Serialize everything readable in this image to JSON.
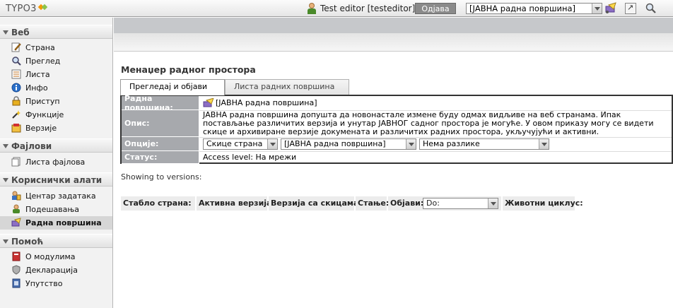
{
  "topbar": {
    "logo_text": "TYPO3",
    "user_label": "Test editor [testeditor]",
    "logout_label": "Одјава",
    "workspace_select": "[ЈАВНА радна површина]"
  },
  "sidebar": {
    "groups": [
      {
        "label": "Веб",
        "items": [
          {
            "label": "Страна"
          },
          {
            "label": "Преглед"
          },
          {
            "label": "Листа"
          },
          {
            "label": "Инфо"
          },
          {
            "label": "Приступ"
          },
          {
            "label": "Функције"
          },
          {
            "label": "Верзије"
          }
        ]
      },
      {
        "label": "Фајлови",
        "items": [
          {
            "label": "Листа фајлова"
          }
        ]
      },
      {
        "label": "Кориснички алати",
        "items": [
          {
            "label": "Центар задатака"
          },
          {
            "label": "Подешавања"
          },
          {
            "label": "Радна површина"
          }
        ]
      },
      {
        "label": "Помоћ",
        "items": [
          {
            "label": "О модулима"
          },
          {
            "label": "Декларација"
          },
          {
            "label": "Упутство"
          }
        ]
      }
    ]
  },
  "main": {
    "title": "Менаџер радног простора",
    "tabs": [
      {
        "label": "Прегледај и објави"
      },
      {
        "label": "Листа радних површина"
      }
    ],
    "info": {
      "workspace_label": "Радна површина:",
      "workspace_value": "[ЈАВНА радна површина]",
      "description_label": "Опис:",
      "description_value": "ЈАВНА радна површина допушта да новонастале измене буду одмах видљиве на веб странама. Ипак постављање различитих верзија и унутар ЈАВНОГ садног простора је могуће. У овом приказу могу се видети скице и архивиране верзије докумената и различитих радних простора, укључујући и активни.",
      "options_label": "Опције:",
      "option_view": "Скице страна",
      "option_workspace": "[ЈАВНА радна површина]",
      "option_diff": "Нема разлике",
      "status_label": "Статус:",
      "status_value": "Access level: На мрежи"
    },
    "showing_text": "Showing to versions:",
    "columns": {
      "page_tree": "Стабло страна:",
      "active_version": "Активна верзија:",
      "draft_version": "Верзија са скицама:",
      "state": "Стање:",
      "publish": "Објави:",
      "publish_select": "Do:",
      "lifecycle": "Животни циклус:"
    }
  }
}
